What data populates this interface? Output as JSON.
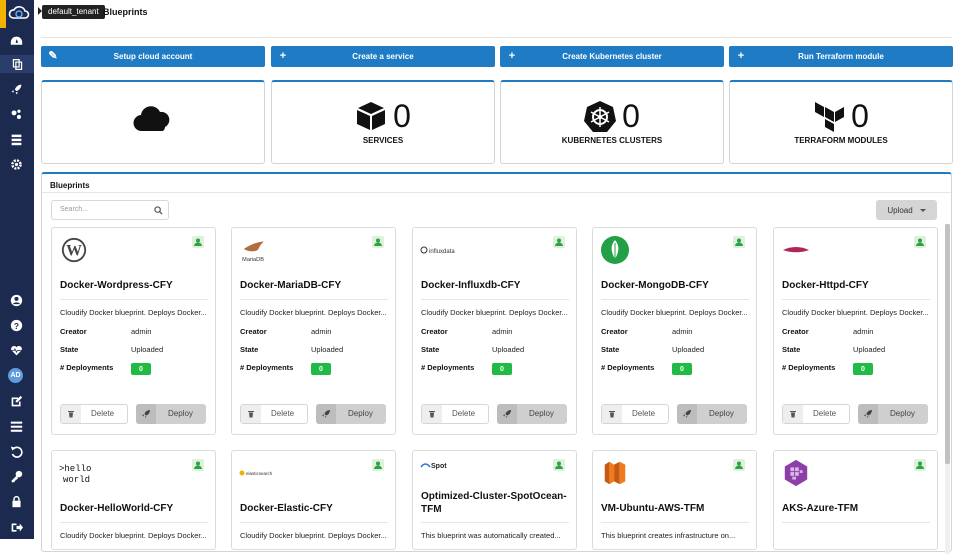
{
  "header": {
    "tenant": "default_tenant",
    "page_title": "Blueprints"
  },
  "sidebar": {
    "top_icons": [
      "dashboard-icon",
      "blueprints-icon",
      "deployments-icon",
      "plugins-icon",
      "inventory-icon",
      "settings-icon"
    ],
    "bottom_icons": [
      "user-icon",
      "help-icon",
      "health-icon",
      "avatar",
      "edit-icon",
      "list-icon",
      "undo-icon",
      "key-icon",
      "lock-icon",
      "logout-icon"
    ],
    "avatar_initials": "AD"
  },
  "actions": [
    {
      "label": "Setup cloud account",
      "icon": "wand-icon"
    },
    {
      "label": "Create a service",
      "icon": "plus-icon"
    },
    {
      "label": "Create Kubernetes cluster",
      "icon": "plus-icon"
    },
    {
      "label": "Run Terraform module",
      "icon": "plus-icon"
    }
  ],
  "stats": [
    {
      "icon": "cloud-icon",
      "count": "",
      "label": ""
    },
    {
      "icon": "cube-icon",
      "count": "0",
      "label": "SERVICES"
    },
    {
      "icon": "kubernetes-icon",
      "count": "0",
      "label": "KUBERNETES CLUSTERS"
    },
    {
      "icon": "terraform-icon",
      "count": "0",
      "label": "TERRAFORM MODULES"
    }
  ],
  "blueprints_panel": {
    "title": "Blueprints",
    "search_placeholder": "Search...",
    "upload_label": "Upload"
  },
  "labels": {
    "creator": "Creator",
    "state": "State",
    "deployments": "# Deployments",
    "delete": "Delete",
    "deploy": "Deploy"
  },
  "blueprints": [
    {
      "name": "Docker-Wordpress-CFY",
      "logo": "wordpress-logo",
      "description": "Cloudify Docker blueprint. Deploys Docker...",
      "creator": "admin",
      "state": "Uploaded",
      "deployments": "0"
    },
    {
      "name": "Docker-MariaDB-CFY",
      "logo": "mariadb-logo",
      "description": "Cloudify Docker blueprint. Deploys Docker...",
      "creator": "admin",
      "state": "Uploaded",
      "deployments": "0"
    },
    {
      "name": "Docker-Influxdb-CFY",
      "logo": "influxdata-logo",
      "description": "Cloudify Docker blueprint. Deploys Docker...",
      "creator": "admin",
      "state": "Uploaded",
      "deployments": "0"
    },
    {
      "name": "Docker-MongoDB-CFY",
      "logo": "mongodb-logo",
      "description": "Cloudify Docker blueprint. Deploys Docker...",
      "creator": "admin",
      "state": "Uploaded",
      "deployments": "0"
    },
    {
      "name": "Docker-Httpd-CFY",
      "logo": "httpd-logo",
      "description": "Cloudify Docker blueprint. Deploys Docker...",
      "creator": "admin",
      "state": "Uploaded",
      "deployments": "0"
    },
    {
      "name": "Docker-HelloWorld-CFY",
      "logo": "helloworld-logo",
      "description": "Cloudify Docker blueprint. Deploys Docker...",
      "creator": "",
      "state": "",
      "deployments": ""
    },
    {
      "name": "Docker-Elastic-CFY",
      "logo": "elasticsearch-logo",
      "description": "Cloudify Docker blueprint. Deploys Docker...",
      "creator": "",
      "state": "",
      "deployments": ""
    },
    {
      "name": "Optimized-Cluster-SpotOcean-TFM",
      "logo": "spot-logo",
      "description": "This blueprint was automatically created...",
      "creator": "",
      "state": "",
      "deployments": ""
    },
    {
      "name": "VM-Ubuntu-AWS-TFM",
      "logo": "aws-logo",
      "description": "This blueprint creates infrastructure on...",
      "creator": "",
      "state": "",
      "deployments": ""
    },
    {
      "name": "AKS-Azure-TFM",
      "logo": "aks-logo",
      "description": "",
      "creator": "",
      "state": "",
      "deployments": ""
    }
  ],
  "logo_texts": {
    "mariadb": "MariaDB",
    "influx": "influxdata",
    "hello": ">hello world",
    "elastic": "elasticsearch",
    "spot": "Spot"
  },
  "colors": {
    "sidebar": "#1b2a4e",
    "primary": "#1f7cc4",
    "badge_green": "#21ba45",
    "tenant_bg": "#222222"
  }
}
